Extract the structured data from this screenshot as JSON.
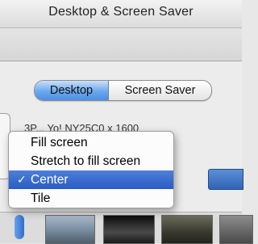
{
  "window": {
    "title": "Desktop & Screen Saver"
  },
  "tabs": [
    {
      "label": "Desktop",
      "selected": true
    },
    {
      "label": "Screen Saver",
      "selected": false
    }
  ],
  "info": {
    "text": "3P... Yo! NY25C0 x 1600"
  },
  "fit_menu": {
    "items": [
      {
        "label": "Fill screen",
        "checked": false
      },
      {
        "label": "Stretch to fill screen",
        "checked": false
      },
      {
        "label": "Center",
        "checked": true
      },
      {
        "label": "Tile",
        "checked": false
      }
    ],
    "checkmark": "✓"
  },
  "colors": {
    "accent": "#3a6fd0",
    "selected_tab": "#6aa8ee"
  }
}
